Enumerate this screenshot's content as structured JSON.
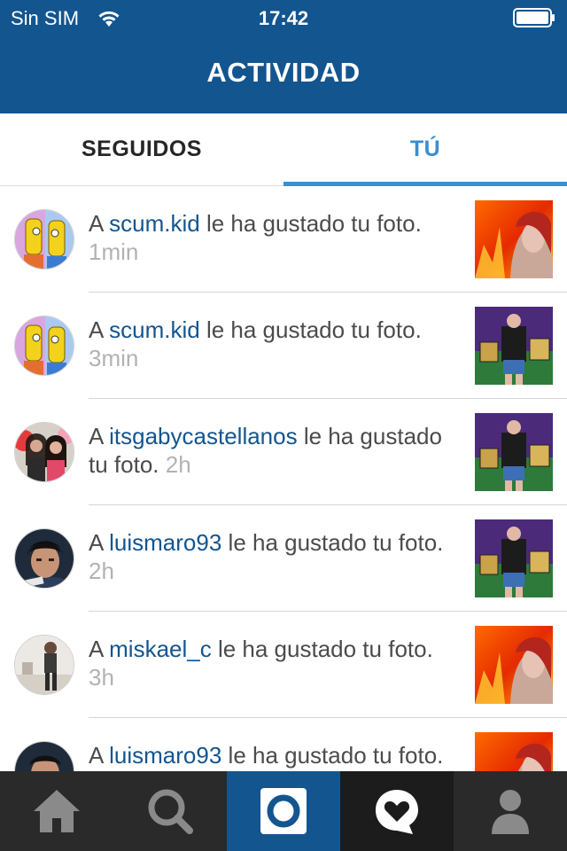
{
  "status_bar": {
    "carrier": "Sin SIM",
    "time": "17:42"
  },
  "header": {
    "title": "ACTIVIDAD"
  },
  "tabs": {
    "following": "SEGUIDOS",
    "you": "TÚ",
    "active": "you"
  },
  "feed": [
    {
      "prefix": "A ",
      "user": "scum.kid",
      "message": " le ha gustado tu foto. ",
      "time": "1min",
      "avatar": "cartoon-yellow-characters",
      "thumb": "fire-portrait"
    },
    {
      "prefix": "A ",
      "user": "scum.kid",
      "message": " le ha gustado tu foto. ",
      "time": "3min",
      "avatar": "cartoon-yellow-characters",
      "thumb": "purple-room-photo"
    },
    {
      "prefix": "A ",
      "user": "itsgabycastellanos",
      "message": " le ha gustado tu foto. ",
      "time": "2h",
      "avatar": "two-girls-photo",
      "thumb": "purple-room-photo"
    },
    {
      "prefix": "A ",
      "user": "luismaro93",
      "message": " le ha gustado tu foto. ",
      "time": "2h",
      "avatar": "boy-portrait",
      "thumb": "purple-room-photo"
    },
    {
      "prefix": "A ",
      "user": "miskael_c",
      "message": " le ha gustado tu foto. ",
      "time": "3h",
      "avatar": "man-standing-photo",
      "thumb": "fire-portrait"
    },
    {
      "prefix": "A ",
      "user": "luismaro93",
      "message": " le ha gustado tu foto. ",
      "time": "",
      "avatar": "boy-portrait",
      "thumb": "fire-portrait"
    }
  ],
  "tabbar": {
    "items": [
      "home-icon",
      "search-icon",
      "camera-icon",
      "news-heart-icon",
      "profile-icon"
    ],
    "active": "news-heart-icon"
  },
  "colors": {
    "brand": "#13558f",
    "accent": "#3a8ed3",
    "tabbar": "#2a2a2a"
  }
}
